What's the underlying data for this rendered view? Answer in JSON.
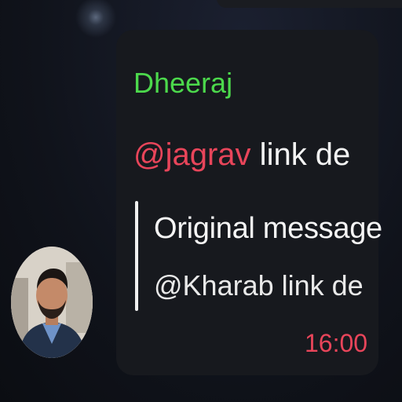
{
  "chat": {
    "sender_name": "Dheeraj",
    "message": {
      "mention": "@jagrav",
      "text": " link de"
    },
    "reply_quote": {
      "title": "Original message",
      "text": "@Kharab link de"
    },
    "timestamp": "16:00"
  },
  "colors": {
    "sender_name": "#4cd94c",
    "mention": "#e8455a",
    "timestamp": "#e8455a",
    "bubble": "#17191e"
  },
  "icons": {
    "avatar": "user-photo"
  }
}
